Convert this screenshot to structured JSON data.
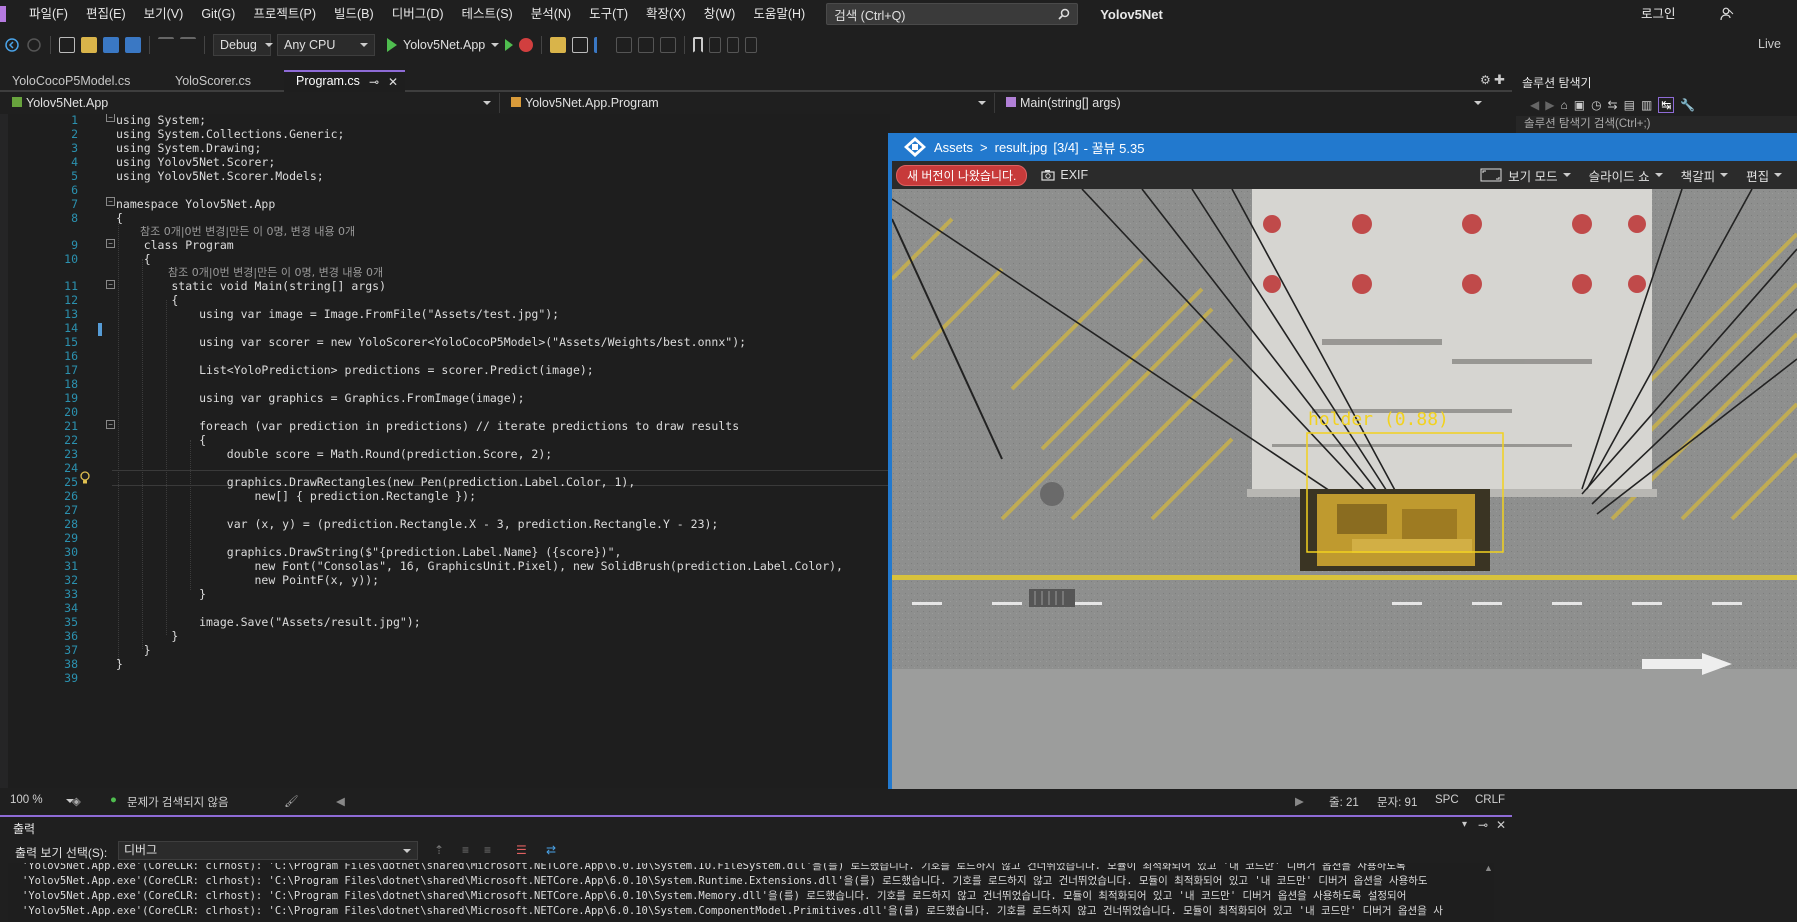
{
  "menubar": {
    "items": [
      "파일(F)",
      "편집(E)",
      "보기(V)",
      "Git(G)",
      "프로젝트(P)",
      "빌드(B)",
      "디버그(D)",
      "테스트(S)",
      "분석(N)",
      "도구(T)",
      "확장(X)",
      "창(W)",
      "도움말(H)"
    ],
    "search_placeholder": "검색 (Ctrl+Q)",
    "solution_name": "Yolov5Net",
    "login": "로그인"
  },
  "toolbar": {
    "configuration": "Debug",
    "platform": "Any CPU",
    "startup_project": "Yolov5Net.App",
    "live_share": "Live"
  },
  "tabs": [
    {
      "label": "YoloCocoP5Model.cs",
      "active": false
    },
    {
      "label": "YoloScorer.cs",
      "active": false
    },
    {
      "label": "Program.cs",
      "active": true
    }
  ],
  "navbar": {
    "project": "Yolov5Net.App",
    "type": "Yolov5Net.App.Program",
    "member": "Main(string[] args)"
  },
  "code": {
    "line_numbers": [
      "1",
      "2",
      "3",
      "4",
      "5",
      "6",
      "7",
      "8",
      "9",
      "10",
      "11",
      "12",
      "13",
      "14",
      "15",
      "16",
      "17",
      "18",
      "19",
      "20",
      "21",
      "22",
      "23",
      "24",
      "25",
      "26",
      "27",
      "28",
      "29",
      "30",
      "31",
      "32",
      "33",
      "34",
      "35",
      "36",
      "37",
      "38",
      "39"
    ],
    "lens_class": "참조 0개|0번 변경|만든 이 0명, 변경 내용 0개",
    "lens_method": "참조 0개|0번 변경|만든 이 0명, 변경 내용 0개",
    "lines": {
      "l1": "using System;",
      "l2": "using System.Collections.Generic;",
      "l3": "using System.Drawing;",
      "l4": "using Yolov5Net.Scorer;",
      "l5": "using Yolov5Net.Scorer.Models;",
      "l7": "namespace Yolov5Net.App",
      "l8": "{",
      "l9": "    class Program",
      "l10": "    {",
      "l11": "        static void Main(string[] args)",
      "l12": "        {",
      "l13": "            using var image = Image.FromFile(\"Assets/test.jpg\");",
      "l15": "            using var scorer = new YoloScorer<YoloCocoP5Model>(\"Assets/Weights/best.onnx\");",
      "l17": "            List<YoloPrediction> predictions = scorer.Predict(image);",
      "l19": "            using var graphics = Graphics.FromImage(image);",
      "l21": "            foreach (var prediction in predictions) // iterate predictions to draw results",
      "l22": "            {",
      "l23": "                double score = Math.Round(prediction.Score, 2);",
      "l25": "                graphics.DrawRectangles(new Pen(prediction.Label.Color, 1),",
      "l26": "                    new[] { prediction.Rectangle });",
      "l28": "                var (x, y) = (prediction.Rectangle.X - 3, prediction.Rectangle.Y - 23);",
      "l30": "                graphics.DrawString($\"{prediction.Label.Name} ({score})\",",
      "l31": "                    new Font(\"Consolas\", 16, GraphicsUnit.Pixel), new SolidBrush(prediction.Label.Color),",
      "l32": "                    new PointF(x, y));",
      "l33": "            }",
      "l35": "            image.Save(\"Assets/result.jpg\");",
      "l36": "        }",
      "l37": "    }",
      "l38": "}"
    }
  },
  "viewer": {
    "breadcrumb_root": "Assets",
    "breadcrumb_sep": ">",
    "file": "result.jpg",
    "position": "[3/4]",
    "app": "- 꿀뷰 5.35",
    "new_version": "새 버전이 나왔습니다.",
    "exif": "EXIF",
    "view_mode": "보기 모드",
    "slideshow": "슬라이드 쇼",
    "bookmark": "책갈피",
    "edit": "편집",
    "detection_label": "holder (0.88)",
    "detection_color": "#f2d21f"
  },
  "statusbar": {
    "zoom": "100 %",
    "issues": "문제가 검색되지 않음",
    "line": "줄: 21",
    "col": "문자: 91",
    "spc": "SPC",
    "eol": "CRLF"
  },
  "output": {
    "title": "출력",
    "source_label": "출력 보기 선택(S):",
    "source_value": "디버그",
    "lines": [
      "'Yolov5Net.App.exe'(CoreCLR: clrhost): 'C:\\Program Files\\dotnet\\shared\\Microsoft.NETCore.App\\6.0.10\\System.IO.FileSystem.dll'을(를) 로드했습니다. 기호를 로드하지 않고 건너뛰었습니다. 모듈이 최적화되어 있고 '내 코드만' 디버거 옵션을 사용하도록",
      "'Yolov5Net.App.exe'(CoreCLR: clrhost): 'C:\\Program Files\\dotnet\\shared\\Microsoft.NETCore.App\\6.0.10\\System.Runtime.Extensions.dll'을(를) 로드했습니다. 기호를 로드하지 않고 건너뛰었습니다. 모듈이 최적화되어 있고 '내 코드만' 디버거 옵션을 사용하도",
      "'Yolov5Net.App.exe'(CoreCLR: clrhost): 'C:\\Program Files\\dotnet\\shared\\Microsoft.NETCore.App\\6.0.10\\System.Memory.dll'을(를) 로드했습니다. 기호를 로드하지 않고 건너뛰었습니다. 모듈이 최적화되어 있고 '내 코드만' 디버거 옵션을 사용하도록 설정되어",
      "'Yolov5Net.App.exe'(CoreCLR: clrhost): 'C:\\Program Files\\dotnet\\shared\\Microsoft.NETCore.App\\6.0.10\\System.ComponentModel.Primitives.dll'을(를) 로드했습니다. 기호를 로드하지 않고 건너뛰었습니다. 모듈이 최적화되어 있고 '내 코드만' 디버거 옵션을 사"
    ]
  },
  "solution_explorer": {
    "title": "솔루션 탐색기",
    "search_placeholder": "솔루션 탐색기 검색(Ctrl+;)"
  },
  "colors": {
    "accent": "#8e6bd6",
    "viewer_frame": "#2279ce",
    "new_version_badge": "#c73a3a"
  }
}
